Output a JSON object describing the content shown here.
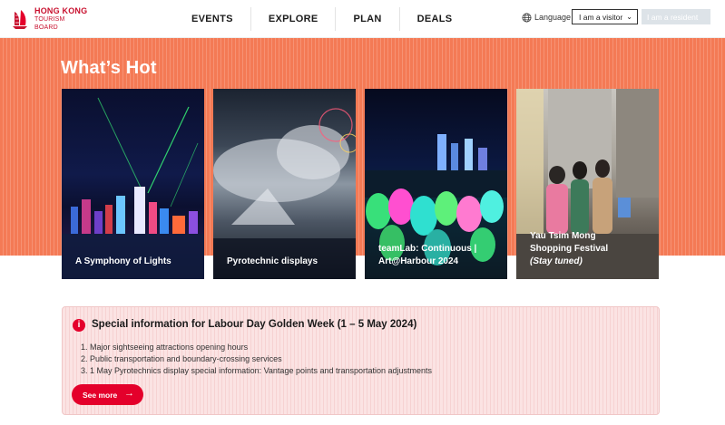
{
  "header": {
    "logo": {
      "line1": "HONG KONG",
      "line2": "TOURISM BOARD",
      "icon": "junk-boat-logo"
    },
    "nav": [
      "EVENTS",
      "EXPLORE",
      "PLAN",
      "DEALS"
    ],
    "language_label": "Language",
    "visitor_select": "I am a visitor",
    "resident_button": "I am a resident"
  },
  "hot": {
    "title": "What’s Hot",
    "cards": [
      {
        "line1": "A Symphony of Lights",
        "line2": "",
        "line3": ""
      },
      {
        "line1": "Pyrotechnic displays",
        "line2": "",
        "line3": ""
      },
      {
        "line1": "teamLab: Continuous |",
        "line2": "Art@Harbour 2024",
        "line3": ""
      },
      {
        "line1": "Yau Tsim Mong",
        "line2": "Shopping Festival",
        "line3": "(Stay tuned)"
      }
    ]
  },
  "info": {
    "icon": "alert-icon",
    "title": "Special information for Labour Day Golden Week (1 – 5 May 2024)",
    "items": [
      "1. Major sightseeing attractions opening hours",
      "2. Public transportation and boundary-crossing services",
      "3. 1 May Pyrotechnics display special information: Vantage points and transportation adjustments"
    ],
    "button": "See more"
  },
  "colors": {
    "brand_red": "#e4002b",
    "hot_band": "#f47a55",
    "info_bg": "#fbe3e3"
  }
}
